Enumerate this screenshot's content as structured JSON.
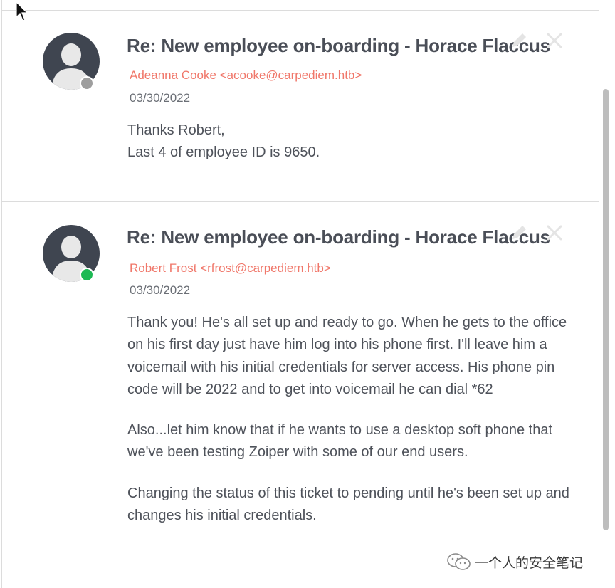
{
  "messages": [
    {
      "subject": "Re: New employee on-boarding - Horace Flaccus",
      "sender": "Adeanna Cooke <acooke@carpediem.htb>",
      "date": "03/30/2022",
      "status": "offline",
      "status_color": "#9e9e9e",
      "body": [
        "Thanks Robert,",
        "Last 4 of employee ID is 9650."
      ]
    },
    {
      "subject": "Re: New employee on-boarding - Horace Flaccus",
      "sender": "Robert Frost <rfrost@carpediem.htb>",
      "date": "03/30/2022",
      "status": "online",
      "status_color": "#1db954",
      "body": [
        "Thank you! He's all set up and ready to go. When he gets to the office on his first day just have him log into his phone first. I'll leave him a voicemail with his initial credentials for server access. His phone pin code will be 2022 and to get into voicemail he can dial *62",
        "Also...let him know that if he wants to use a desktop soft phone that we've been testing Zoiper with some of our end users.",
        "Changing the status of this ticket to pending until he's been set up and changes his initial credentials."
      ]
    }
  ],
  "watermark": {
    "text": "一个人的安全笔记",
    "icon": "wechat-icon"
  },
  "icons": {
    "edit": "pencil-icon",
    "close": "close-icon",
    "avatar": "user-avatar-icon",
    "cursor": "mouse-pointer-icon"
  }
}
